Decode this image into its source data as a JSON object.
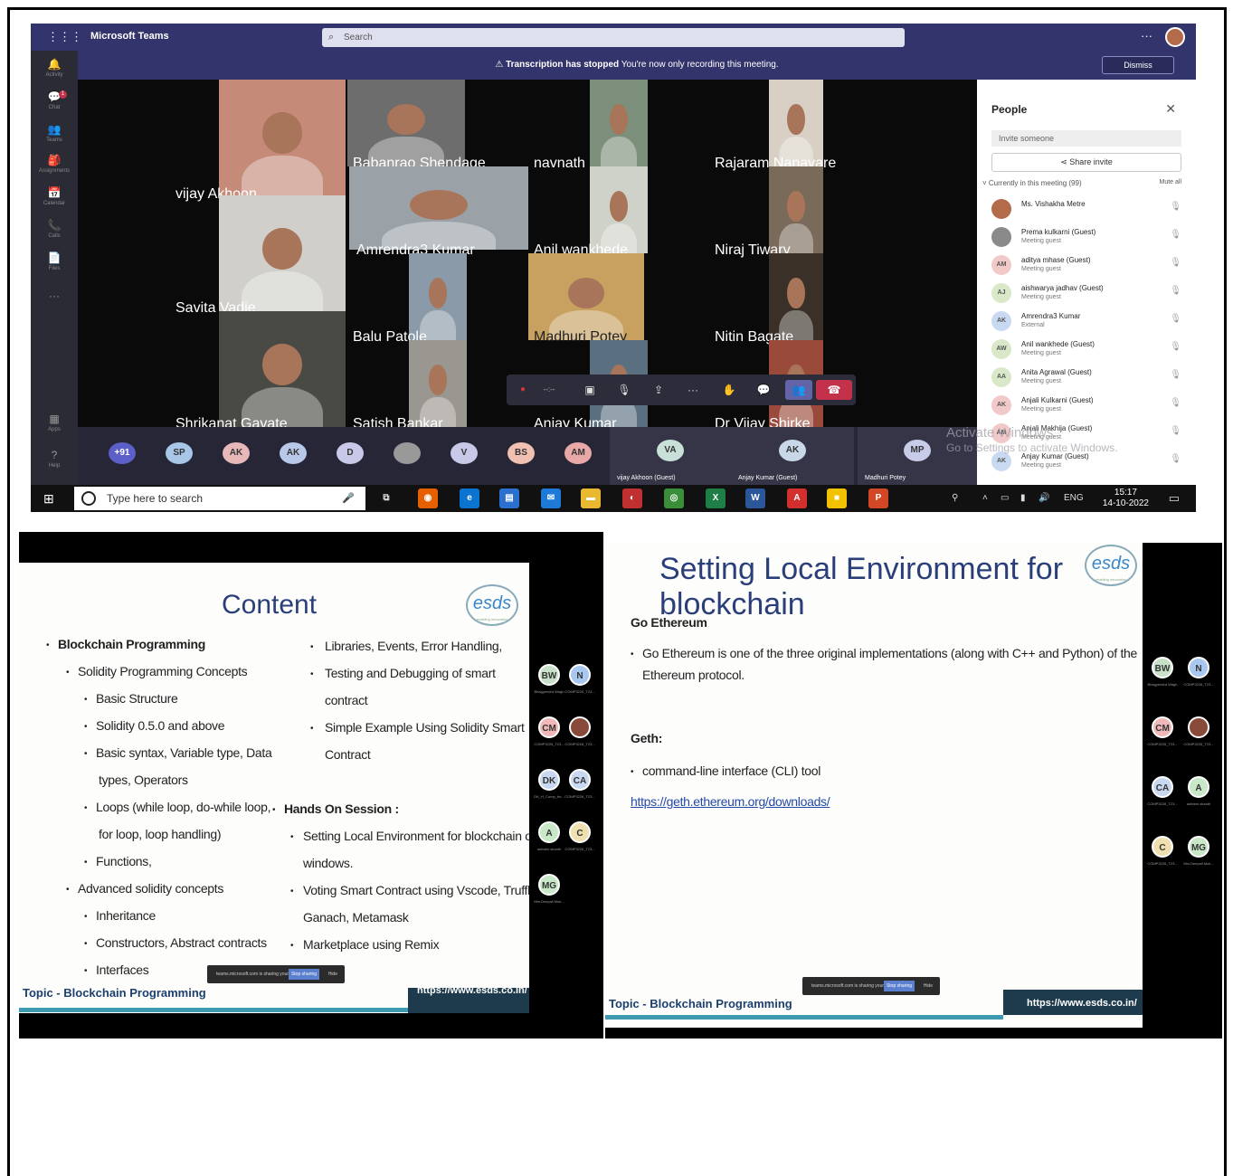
{
  "teams": {
    "app_title": "Microsoft Teams",
    "search_placeholder": "Search",
    "more": "···",
    "rail": [
      {
        "icon": "activity-bell-icon",
        "glyph": "🔔",
        "label": "Activity"
      },
      {
        "icon": "chat-icon",
        "glyph": "💬",
        "label": "Chat",
        "badge": "1"
      },
      {
        "icon": "teams-icon",
        "glyph": "👥",
        "label": "Teams"
      },
      {
        "icon": "assignments-icon",
        "glyph": "🎒",
        "label": "Assignments"
      },
      {
        "icon": "calendar-icon",
        "glyph": "📅",
        "label": "Calendar"
      },
      {
        "icon": "calls-icon",
        "glyph": "📞",
        "label": "Calls"
      },
      {
        "icon": "files-icon",
        "glyph": "📄",
        "label": "Files"
      },
      {
        "icon": "more-apps-icon",
        "glyph": "···",
        "label": ""
      },
      {
        "icon": "apps-icon",
        "glyph": "▦",
        "label": "Apps"
      },
      {
        "icon": "help-icon",
        "glyph": "?",
        "label": "Help"
      }
    ],
    "banner": {
      "bold": "Transcription has stopped",
      "text": "You're now only recording this meeting.",
      "dismiss": "Dismiss"
    },
    "tiles": [
      "vijay Akhoon",
      "Babanrao Shendage",
      "navnath",
      "Rajaram Nanavare",
      "Amrendra3 Kumar",
      "Anil wankhede",
      "Niraj Tiwary",
      "Savita Vadje",
      "Balu Patole",
      "Madhuri Potey",
      "Nitin Bagate",
      "Shrikanat Gavate",
      "Satish Bankar",
      "Anjay Kumar",
      "Dr Vijay Shirke"
    ],
    "controls": {
      "timer": "--:--"
    },
    "avatars": [
      {
        "initials": "+91",
        "color": "#5b5fc7",
        "text_color": "#ffffff"
      },
      {
        "initials": "SP",
        "color": "#a8c7e8"
      },
      {
        "initials": "AK",
        "color": "#e8b8b8"
      },
      {
        "initials": "AK",
        "color": "#b8c8e8"
      },
      {
        "initials": "D",
        "color": "#c8c8e8"
      },
      {
        "initials": "",
        "color": "#999999"
      },
      {
        "initials": "V",
        "color": "#c8c8e8"
      },
      {
        "initials": "BS",
        "color": "#f0c0b0"
      },
      {
        "initials": "AM",
        "color": "#e8a8a8"
      }
    ],
    "video_slots": [
      {
        "initials": "VA",
        "name": "vijay Akhoon (Guest)",
        "color": "#c8e0d8"
      },
      {
        "initials": "AK",
        "name": "Anjay Kumar (Guest)",
        "color": "#c8d8e8"
      },
      {
        "initials": "MP",
        "name": "Madhuri Potey",
        "color": "#c8cce8"
      }
    ],
    "people": {
      "title": "People",
      "invite_placeholder": "Invite someone",
      "share_invite": "Share invite",
      "section": "Currently in this meeting (99)",
      "mute_all": "Mute all",
      "list": [
        {
          "initials": "",
          "name": "Ms. Vishakha Metre",
          "role": "",
          "color": "#b36b4a"
        },
        {
          "initials": "",
          "name": "Prema kulkarni (Guest)",
          "role": "Meeting guest",
          "color": "#8a8a8a"
        },
        {
          "initials": "AM",
          "name": "aditya mhase (Guest)",
          "role": "Meeting guest",
          "color": "#f2c9c9"
        },
        {
          "initials": "AJ",
          "name": "aishwarya jadhav (Guest)",
          "role": "Meeting guest",
          "color": "#d9e8c8"
        },
        {
          "initials": "AK",
          "name": "Amrendra3 Kumar",
          "role": "External",
          "color": "#c9d9f2"
        },
        {
          "initials": "AW",
          "name": "Anil wankhede (Guest)",
          "role": "Meeting guest",
          "color": "#d9e8c8"
        },
        {
          "initials": "AA",
          "name": "Anita Agrawal (Guest)",
          "role": "Meeting guest",
          "color": "#d9e8c8"
        },
        {
          "initials": "AK",
          "name": "Anjali Kulkarni (Guest)",
          "role": "Meeting guest",
          "color": "#f2c9c9"
        },
        {
          "initials": "AM",
          "name": "Anjali Makhija (Guest)",
          "role": "Meeting guest",
          "color": "#f2c9c9"
        },
        {
          "initials": "AK",
          "name": "Anjay Kumar (Guest)",
          "role": "Meeting guest",
          "color": "#c9d9f2"
        }
      ]
    },
    "watermark": {
      "line1": "Activate Windows",
      "line2": "Go to Settings to activate Windows."
    },
    "taskbar": {
      "search": "Type here to search",
      "lang": "ENG",
      "time": "15:17",
      "date": "14-10-2022"
    }
  },
  "slide1": {
    "title": "Content",
    "logo": "esds",
    "logo_tag": "enabling innovation",
    "left": [
      {
        "level": 0,
        "text": "Blockchain Programming",
        "bold": true
      },
      {
        "level": 1,
        "text": "Solidity Programming Concepts"
      },
      {
        "level": 2,
        "text": "Basic Structure"
      },
      {
        "level": 2,
        "text": "Solidity 0.5.0 and above"
      },
      {
        "level": 2,
        "text": "Basic syntax, Variable type, Data"
      },
      {
        "level": 3,
        "text": "types, Operators"
      },
      {
        "level": 2,
        "text": "Loops (while loop, do-while loop,"
      },
      {
        "level": 3,
        "text": "for loop, loop handling)"
      },
      {
        "level": 2,
        "text": "Functions,"
      },
      {
        "level": 1,
        "text": "Advanced solidity concepts"
      },
      {
        "level": 2,
        "text": "Inheritance"
      },
      {
        "level": 2,
        "text": "Constructors, Abstract contracts"
      },
      {
        "level": 2,
        "text": "Interfaces"
      }
    ],
    "right": [
      {
        "text": "Libraries, Events, Error Handling,",
        "bullet": true
      },
      {
        "text": "Testing   and   Debugging   of   smart",
        "bullet": true
      },
      {
        "text": "contract",
        "bullet": false
      },
      {
        "text": "Simple  Example  Using  Solidity  Smart",
        "bullet": true
      },
      {
        "text": "Contract",
        "bullet": false
      }
    ],
    "hands_on": {
      "heading": "Hands On Session :",
      "items": [
        {
          "text": "Setting Local Environment for blockchain on",
          "bullet": true
        },
        {
          "text": "windows.",
          "bullet": false
        },
        {
          "text": "Voting Smart Contract using Vscode, Truffle,",
          "bullet": true
        },
        {
          "text": "Ganach, Metamask",
          "bullet": false
        },
        {
          "text": "Marketplace using Remix",
          "bullet": true
        }
      ]
    },
    "topic": "Topic - Blockchain Programming",
    "url": "https://www.esds.co.in/",
    "share_bar": {
      "text": "teams.microsoft.com is sharing your screen.",
      "stop": "Stop sharing",
      "hide": "Hide"
    },
    "thumbs": [
      {
        "initials": "BW",
        "label": "Bhagyendra Wagh",
        "color": "#c8e0c8"
      },
      {
        "initials": "N",
        "label": "COMP3226_T23...",
        "color": "#a8c8f0"
      },
      {
        "initials": "CM",
        "label": "COMP3226_T23...",
        "color": "#f0b8b8"
      },
      {
        "initials": "",
        "label": "COMP3226_T23...",
        "color": "#8a4a3a"
      },
      {
        "initials": "DK",
        "label": "DK_H_Comp_be...",
        "color": "#c8d8f0"
      },
      {
        "initials": "CA",
        "label": "COMP3226_T23...",
        "color": "#c8d8f0"
      },
      {
        "initials": "A",
        "label": "ashwini.sirsath",
        "color": "#c8e8c8"
      },
      {
        "initials": "C",
        "label": "COMP3226_T23...",
        "color": "#f0e0b0"
      },
      {
        "initials": "MG",
        "label": "Mrs.Deepali Muk...",
        "color": "#c8e8c8"
      }
    ]
  },
  "slide2": {
    "title": "Setting Local Environment for blockchain",
    "logo": "esds",
    "logo_tag": "enabling innovation",
    "h1": "Go Ethereum",
    "p1a": "Go Ethereum is one of the three original implementations (along with C++ and Python) of the",
    "p1b": "Ethereum protocol.",
    "h2": "Geth:",
    "p2": "command-line interface (CLI) tool",
    "link": "https://geth.ethereum.org/downloads/",
    "topic": "Topic - Blockchain Programming",
    "url": "https://www.esds.co.in/",
    "share_bar": {
      "text": "teams.microsoft.com is sharing your screen.",
      "stop": "Stop sharing",
      "hide": "Hide"
    },
    "thumbs": [
      {
        "initials": "BW",
        "label": "Bhagyendra Wagh",
        "color": "#c8e0c8"
      },
      {
        "initials": "N",
        "label": "COMP3226_T23...",
        "color": "#a8c8f0"
      },
      {
        "initials": "CM",
        "label": "COMP3226_T23...",
        "color": "#f0b8b8"
      },
      {
        "initials": "",
        "label": "COMP3226_T23...",
        "color": "#8a4a3a"
      },
      {
        "initials": "CA",
        "label": "COMP3226_T23...",
        "color": "#c8d8f0"
      },
      {
        "initials": "A",
        "label": "ashwini.sirsath",
        "color": "#c8e8c8"
      },
      {
        "initials": "C",
        "label": "COMP3226_T23...",
        "color": "#f0e0b0"
      },
      {
        "initials": "MG",
        "label": "Mrs.Deepali Muk...",
        "color": "#c8e8c8"
      }
    ]
  }
}
